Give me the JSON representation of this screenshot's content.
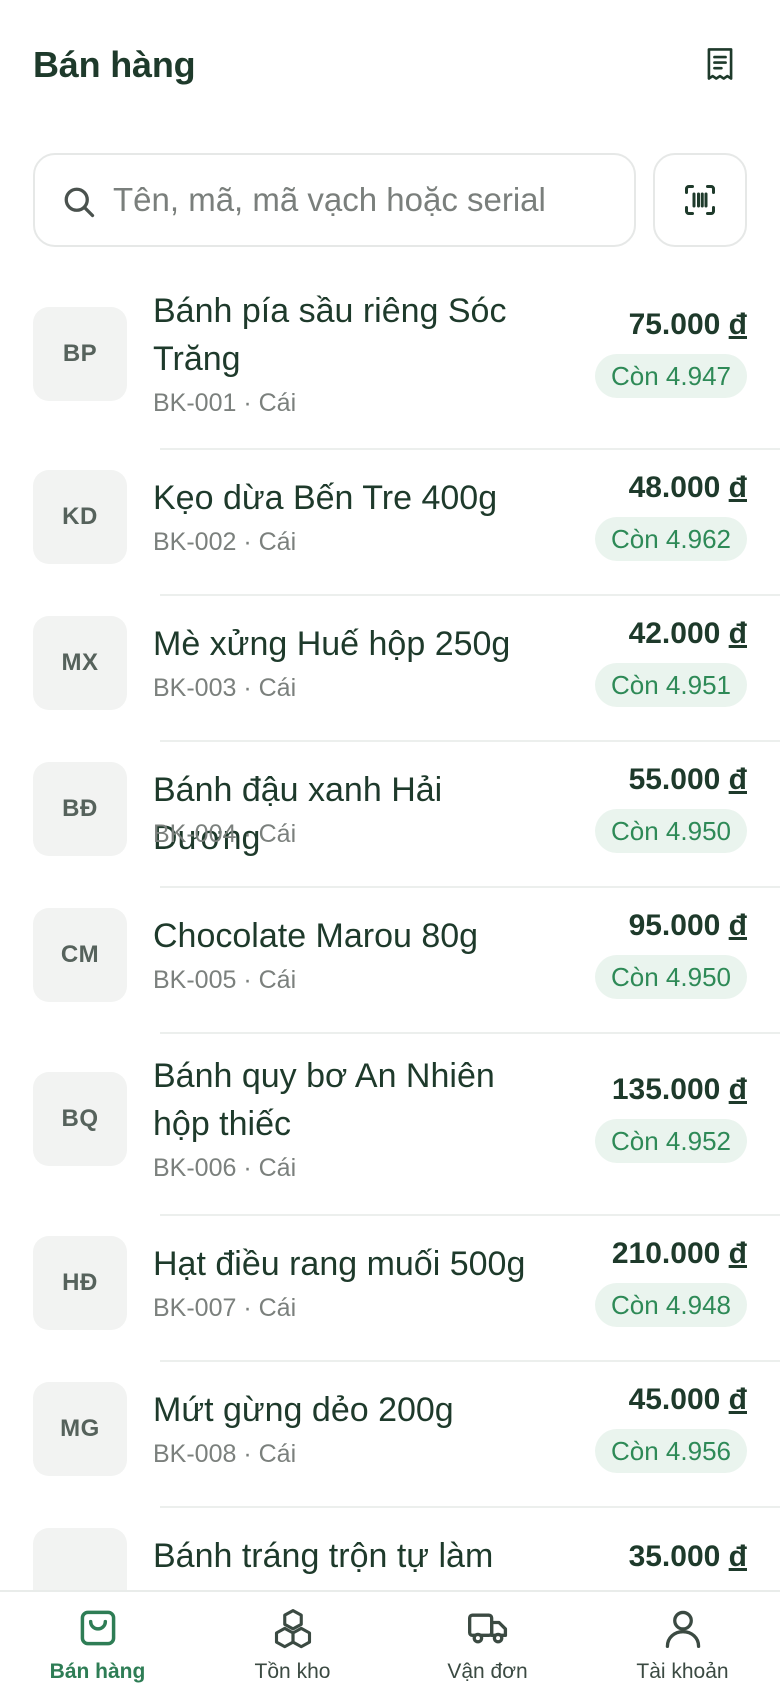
{
  "header": {
    "title": "Bán hàng",
    "receipt_icon": "receipt-icon"
  },
  "search": {
    "placeholder": "Tên, mã, mã vạch hoặc serial",
    "value": "",
    "search_icon": "search-icon",
    "scan_icon": "barcode-scan-icon"
  },
  "colors": {
    "accent": "#2e8a57",
    "text": "#1e3a2b",
    "muted": "#7b807d",
    "badge_bg": "#eaf4ee",
    "avatar_bg": "#f2f3f2"
  },
  "products": [
    {
      "initials": "BP",
      "name": "Bánh pía sầu riêng Sóc Trăng",
      "code": "BK-001",
      "unit": "Cái",
      "price": "75.000",
      "currency": "đ",
      "stock": "Còn 4.947"
    },
    {
      "initials": "KD",
      "name": "Kẹo dừa Bến Tre 400g",
      "code": "BK-002",
      "unit": "Cái",
      "price": "48.000",
      "currency": "đ",
      "stock": "Còn 4.962"
    },
    {
      "initials": "MX",
      "name": "Mè xửng Huế hộp 250g",
      "code": "BK-003",
      "unit": "Cái",
      "price": "42.000",
      "currency": "đ",
      "stock": "Còn 4.951"
    },
    {
      "initials": "BĐ",
      "name": "Bánh đậu xanh Hải Dương",
      "code": "BK-004",
      "unit": "Cái",
      "price": "55.000",
      "currency": "đ",
      "stock": "Còn 4.950"
    },
    {
      "initials": "CM",
      "name": "Chocolate Marou 80g",
      "code": "BK-005",
      "unit": "Cái",
      "price": "95.000",
      "currency": "đ",
      "stock": "Còn 4.950"
    },
    {
      "initials": "BQ",
      "name": "Bánh quy bơ An Nhiên hộp thiếc",
      "code": "BK-006",
      "unit": "Cái",
      "price": "135.000",
      "currency": "đ",
      "stock": "Còn 4.952"
    },
    {
      "initials": "HĐ",
      "name": "Hạt điều rang muối 500g",
      "code": "BK-007",
      "unit": "Cái",
      "price": "210.000",
      "currency": "đ",
      "stock": "Còn 4.948"
    },
    {
      "initials": "MG",
      "name": "Mứt gừng dẻo 200g",
      "code": "BK-008",
      "unit": "Cái",
      "price": "45.000",
      "currency": "đ",
      "stock": "Còn 4.956"
    },
    {
      "initials": "",
      "name": "Bánh tráng trộn tự làm",
      "code": "",
      "unit": "",
      "price": "35.000",
      "currency": "đ",
      "stock": ""
    }
  ],
  "nav": {
    "items": [
      {
        "label": "Bán hàng",
        "icon": "shopping-bag-icon",
        "active": true
      },
      {
        "label": "Tồn kho",
        "icon": "boxes-icon",
        "active": false
      },
      {
        "label": "Vận đơn",
        "icon": "truck-icon",
        "active": false
      },
      {
        "label": "Tài khoản",
        "icon": "user-icon",
        "active": false
      }
    ]
  }
}
